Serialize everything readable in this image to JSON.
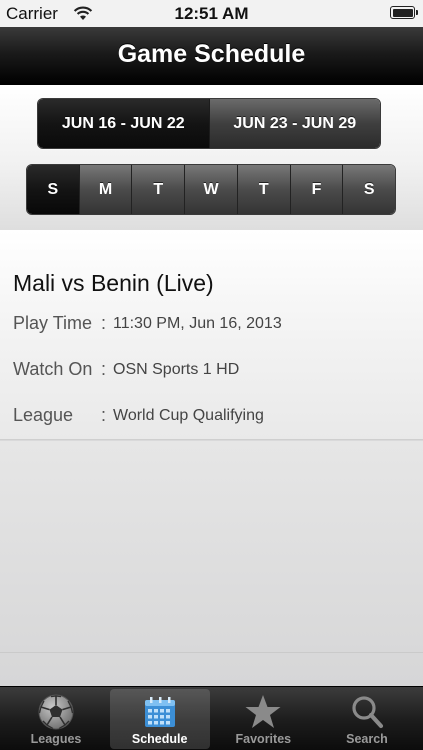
{
  "status_bar": {
    "carrier": "Carrier",
    "time": "12:51 AM",
    "wifi_icon": "wifi-icon",
    "battery_icon": "battery-icon"
  },
  "header": {
    "title": "Game Schedule"
  },
  "week_selector": {
    "weeks": [
      {
        "label": "JUN 16 - JUN 22",
        "selected": true
      },
      {
        "label": "JUN 23 - JUN 29",
        "selected": false
      }
    ]
  },
  "day_selector": {
    "days": [
      {
        "label": "S",
        "selected": true
      },
      {
        "label": "M",
        "selected": false
      },
      {
        "label": "T",
        "selected": false
      },
      {
        "label": "W",
        "selected": false
      },
      {
        "label": "T",
        "selected": false
      },
      {
        "label": "F",
        "selected": false
      },
      {
        "label": "S",
        "selected": false
      }
    ]
  },
  "game": {
    "match": "Mali vs Benin (Live)",
    "play_time_label": "Play Time",
    "play_time_value": "11:30 PM, Jun 16, 2013",
    "watch_on_label": "Watch On",
    "watch_on_value": "OSN Sports 1 HD",
    "league_label": "League",
    "league_value": "World Cup Qualifying",
    "separator": ":"
  },
  "tab_bar": {
    "tabs": [
      {
        "label": "Leagues",
        "icon": "soccer-ball-icon",
        "selected": false
      },
      {
        "label": "Schedule",
        "icon": "calendar-icon",
        "selected": true
      },
      {
        "label": "Favorites",
        "icon": "star-icon",
        "selected": false
      },
      {
        "label": "Search",
        "icon": "search-icon",
        "selected": false
      }
    ]
  },
  "colors": {
    "title_bar": "#1b1b1b",
    "selected_tab_icon": "#4a9fe0",
    "inactive_tab_icon": "#8c8c8c"
  }
}
